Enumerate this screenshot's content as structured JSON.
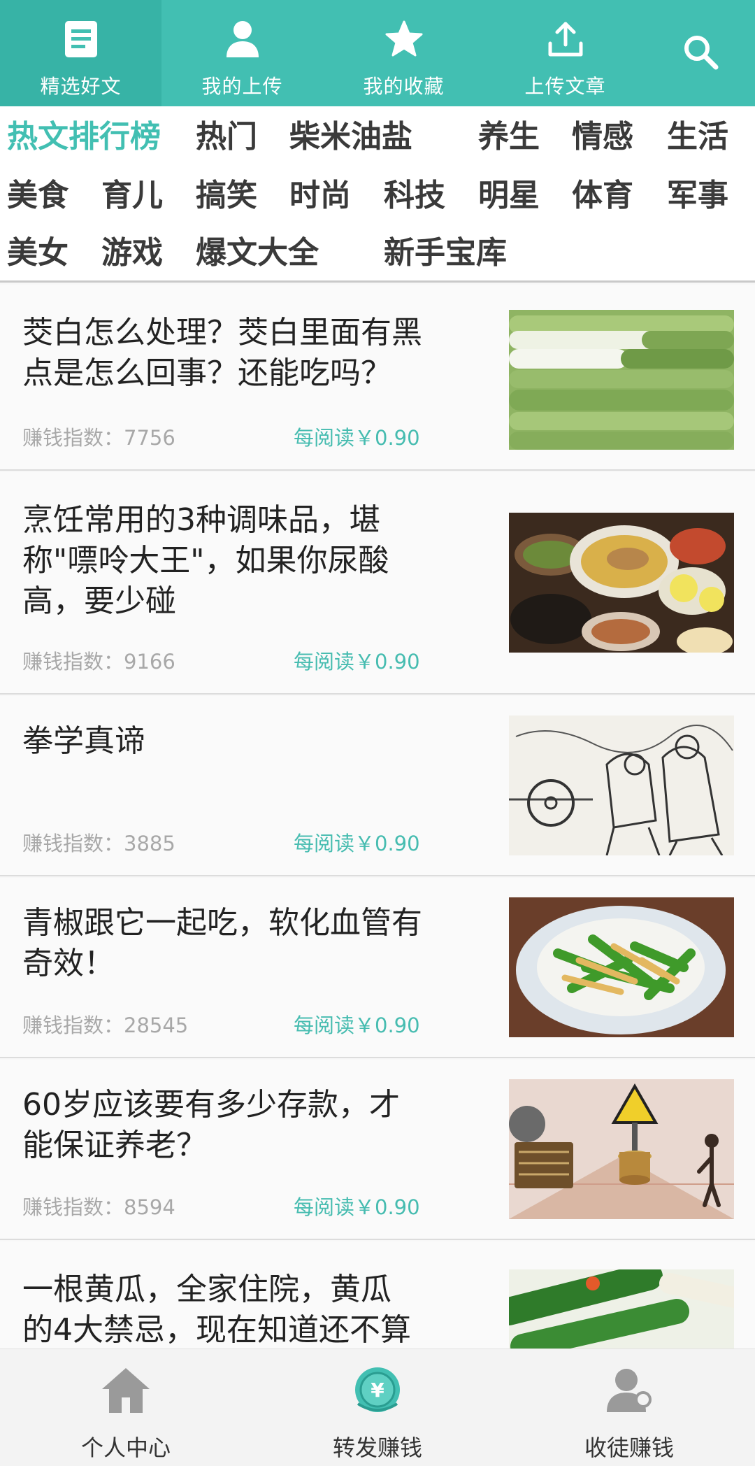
{
  "topnav": {
    "tabs": [
      {
        "label": "精选好文",
        "icon": "article-icon"
      },
      {
        "label": "我的上传",
        "icon": "user-icon"
      },
      {
        "label": "我的收藏",
        "icon": "star-icon"
      },
      {
        "label": "上传文章",
        "icon": "upload-icon"
      }
    ],
    "search_icon": "search-icon",
    "accent_color": "#42bfb2"
  },
  "categories": [
    "热文排行榜",
    "热门",
    "柴米油盐",
    "养生",
    "情感",
    "生活",
    "美食",
    "育儿",
    "搞笑",
    "时尚",
    "科技",
    "明星",
    "体育",
    "军事",
    "美女",
    "游戏",
    "爆文大全",
    "新手宝库"
  ],
  "articles": [
    {
      "title_lines": [
        "茭白怎么处理？茭白里面有黑",
        "点是怎么回事？还能吃吗？"
      ],
      "index": "赚钱指数：7756",
      "reward": "每阅读￥0.90"
    },
    {
      "title_lines": [
        "烹饪常用的3种调味品，堪",
        "称\"嘌呤大王\"，如果你尿酸",
        "高，要少碰"
      ],
      "index": "赚钱指数：9166",
      "reward": "每阅读￥0.90"
    },
    {
      "title_lines": [
        "拳学真谛"
      ],
      "index": "赚钱指数：3885",
      "reward": "每阅读￥0.90"
    },
    {
      "title_lines": [
        "青椒跟它一起吃，软化血管有",
        "奇效！"
      ],
      "index": "赚钱指数：28545",
      "reward": "每阅读￥0.90"
    },
    {
      "title_lines": [
        "60岁应该要有多少存款，才",
        "能保证养老？"
      ],
      "index": "赚钱指数：8594",
      "reward": "每阅读￥0.90"
    },
    {
      "title_lines": [
        "一根黄瓜，全家住院，黄瓜",
        "的4大禁忌，现在知道还不算"
      ],
      "index": "",
      "reward": ""
    }
  ],
  "bottomnav": [
    {
      "label": "个人中心",
      "icon": "home-icon"
    },
    {
      "label": "转发赚钱",
      "icon": "yuan-coin-icon"
    },
    {
      "label": "收徒赚钱",
      "icon": "recruit-user-icon"
    }
  ]
}
